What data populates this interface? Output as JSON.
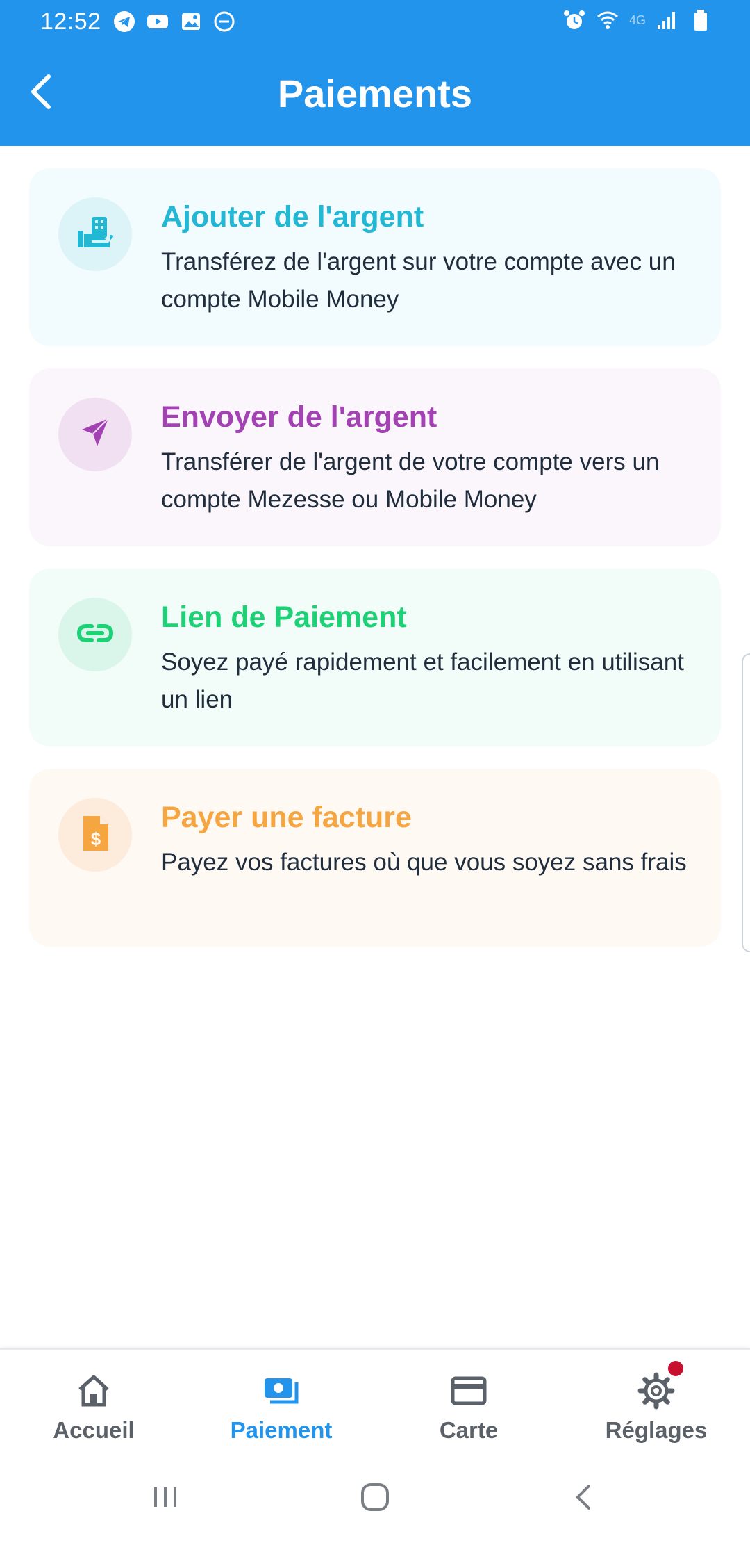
{
  "status_bar": {
    "time": "12:52",
    "left_icons": [
      "telegram-icon",
      "youtube-icon",
      "gallery-icon",
      "do-not-disturb-icon"
    ],
    "right_icons": [
      "alarm-icon",
      "wifi-icon",
      "4g-icon",
      "signal-icon",
      "battery-icon"
    ],
    "network_label": "4G"
  },
  "header": {
    "title": "Paiements",
    "back_icon": "chevron-left-icon"
  },
  "cards": [
    {
      "title": "Ajouter de l'argent",
      "description": "Transférez de l'argent sur votre compte avec un compte Mobile Money",
      "icon": "hand-deposit-icon",
      "accent": "#22b8d4"
    },
    {
      "title": "Envoyer de l'argent",
      "description": "Transférer de l'argent de votre compte vers un compte Mezesse ou Mobile Money",
      "icon": "send-arrow-icon",
      "accent": "#a343b3"
    },
    {
      "title": "Lien de Paiement",
      "description": "Soyez payé rapidement et facilement en utilisant un lien",
      "icon": "link-icon",
      "accent": "#1ed176"
    },
    {
      "title": "Payer une facture",
      "description": "Payez vos factures où que vous soyez sans frais",
      "icon": "invoice-dollar-icon",
      "accent": "#f6a640"
    }
  ],
  "bottom_nav": {
    "items": [
      {
        "label": "Accueil",
        "icon": "home-icon",
        "active": false
      },
      {
        "label": "Paiement",
        "icon": "payment-icon",
        "active": true
      },
      {
        "label": "Carte",
        "icon": "card-icon",
        "active": false
      },
      {
        "label": "Réglages",
        "icon": "gear-icon",
        "active": false,
        "badge": true
      }
    ],
    "active_color": "#2394ec"
  },
  "system_nav": [
    "recent-apps-icon",
    "home-circle-icon",
    "back-icon"
  ],
  "colors": {
    "primary": "#2394ec",
    "text": "#1f2d3d",
    "badge": "#c70f2e"
  }
}
